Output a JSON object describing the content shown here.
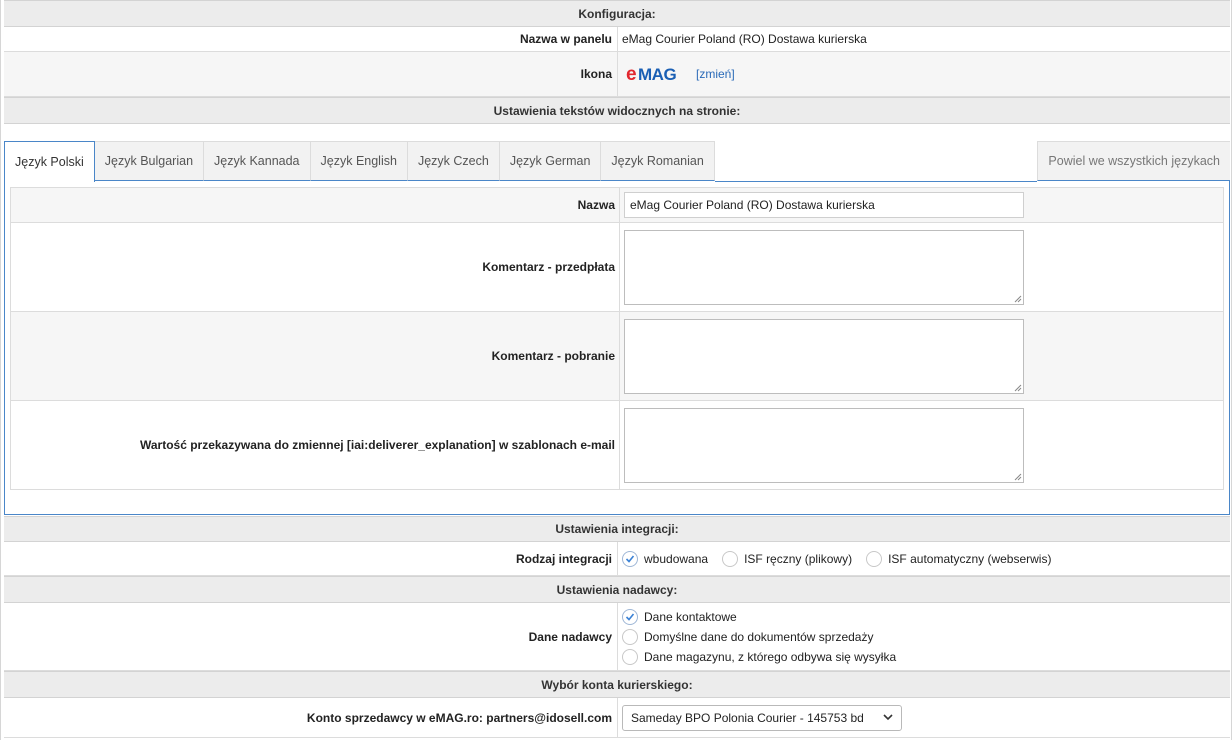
{
  "config": {
    "header": "Konfiguracja:",
    "panel_name_label": "Nazwa w panelu",
    "panel_name_value": "eMag Courier Poland (RO) Dostawa kurierska",
    "icon_label": "Ikona",
    "logo_text": "eMAG",
    "change_link": "[zmień]"
  },
  "texts": {
    "header": "Ustawienia tekstów widocznych na stronie:",
    "tabs": [
      {
        "label": "Język Polski"
      },
      {
        "label": "Język Bulgarian"
      },
      {
        "label": "Język Kannada"
      },
      {
        "label": "Język English"
      },
      {
        "label": "Język Czech"
      },
      {
        "label": "Język German"
      },
      {
        "label": "Język Romanian"
      }
    ],
    "copy_all": "Powiel we wszystkich językach",
    "name_label": "Nazwa",
    "name_value": "eMag Courier Poland (RO) Dostawa kurierska",
    "prepay_label": "Komentarz - przedpłata",
    "cod_label": "Komentarz - pobranie",
    "variable_label": "Wartość przekazywana do zmiennej [iai:deliverer_explanation] w szablonach e-mail"
  },
  "integration": {
    "header": "Ustawienia integracji:",
    "type_label": "Rodzaj integracji",
    "options": [
      "wbudowana",
      "ISF ręczny (plikowy)",
      "ISF automatyczny (webserwis)"
    ],
    "selected": "wbudowana"
  },
  "sender": {
    "header": "Ustawienia nadawcy:",
    "data_label": "Dane nadawcy",
    "options": [
      "Dane kontaktowe",
      "Domyślne dane do dokumentów sprzedaży",
      "Dane magazynu, z którego odbywa się wysyłka"
    ],
    "selected": "Dane kontaktowe"
  },
  "courier": {
    "header": "Wybór konta kurierskiego:",
    "account_label": "Konto sprzedawcy w eMAG.ro: partners@idosell.com",
    "selected": "Sameday BPO Polonia Courier - 145753 bd"
  },
  "colors": {
    "accent": "#4a86c8",
    "logo_red": "#e2272e",
    "logo_blue": "#1a5fb4",
    "header_bg": "#ececec"
  }
}
